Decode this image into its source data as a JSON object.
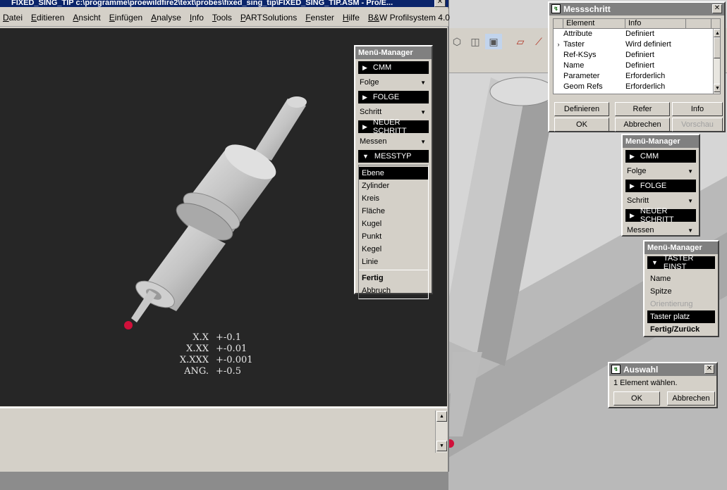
{
  "app": {
    "title": "FIXED_SING_TIP c:\\programme\\proewildfire2\\text\\probes\\fixed_sing_tip\\FIXED_SING_TIP.ASM - Pro/E..."
  },
  "menubar": [
    "Datei",
    "Editieren",
    "Ansicht",
    "Einfügen",
    "Analyse",
    "Info",
    "Tools",
    "PARTSolutions",
    "Fenster",
    "Hilfe",
    "B&W Profilsystem 4.0"
  ],
  "tolerances": [
    {
      "key": "X.X",
      "value": "+-0.1"
    },
    {
      "key": "X.XX",
      "value": "+-0.01"
    },
    {
      "key": "X.XXX",
      "value": "+-0.001"
    },
    {
      "key": "ANG.",
      "value": "+-0.5"
    }
  ],
  "menu_manager_main": {
    "title": "Menü-Manager",
    "cmm": "CMM",
    "folge_dd": "Folge",
    "folge": "FOLGE",
    "schritt_dd": "Schritt",
    "neuer_schritt": "NEUER SCHRITT",
    "messen_dd": "Messen",
    "messtyp": "MESSTYP",
    "items": [
      "Ebene",
      "Zylinder",
      "Kreis",
      "Fläche",
      "Kugel",
      "Punkt",
      "Kegel",
      "Linie"
    ],
    "highlighted": "Ebene",
    "fertig": "Fertig",
    "abbruch": "Abbruch"
  },
  "messschritt": {
    "title": "Messschritt",
    "col_element": "Element",
    "col_info": "Info",
    "rows": [
      {
        "element": "Attribute",
        "info": "Definiert",
        "current": false
      },
      {
        "element": "Taster",
        "info": "Wird definiert",
        "current": true
      },
      {
        "element": "Ref-KSys",
        "info": "Definiert",
        "current": false
      },
      {
        "element": "Name",
        "info": "Definiert",
        "current": false
      },
      {
        "element": "Parameter",
        "info": "Erforderlich",
        "current": false
      },
      {
        "element": "Geom Refs",
        "info": "Erforderlich",
        "current": false
      }
    ],
    "btn_definieren": "Definieren",
    "btn_refer": "Refer",
    "btn_info": "Info",
    "btn_ok": "OK",
    "btn_abbrechen": "Abbrechen",
    "btn_vorschau": "Vorschau"
  },
  "menu_manager_2": {
    "title": "Menü-Manager",
    "cmm": "CMM",
    "folge_dd": "Folge",
    "folge": "FOLGE",
    "schritt_dd": "Schritt",
    "neuer_schritt": "NEUER SCHRITT",
    "messen_dd": "Messen"
  },
  "menu_manager_3": {
    "title": "Menü-Manager",
    "taster_einst": "TASTER EINST",
    "items": [
      "Name",
      "Spitze",
      "Orientierung",
      "Taster platz"
    ],
    "disabled": "Orientierung",
    "highlighted": "Taster platz",
    "fertig": "Fertig/Zurück"
  },
  "auswahl": {
    "title": "Auswahl",
    "message": "1 Element wählen.",
    "btn_ok": "OK",
    "btn_abbrechen": "Abbrechen"
  },
  "colors": {
    "viewport_bg": "#262626",
    "model_gray": "#bdbdbd",
    "probe_tip": "#d0103a",
    "title_active": "#0a246a"
  }
}
